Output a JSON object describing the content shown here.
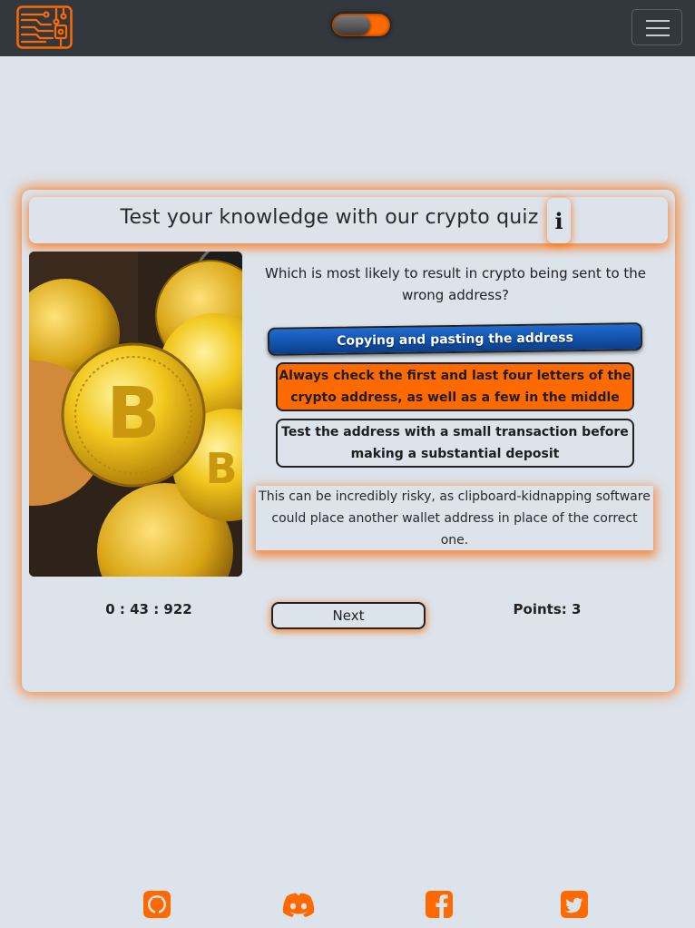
{
  "navbar": {
    "logo_icon": "circuit-chip-icon",
    "theme_toggle": "dark-mode-toggle",
    "menu_icon": "hamburger-icon"
  },
  "quiz": {
    "title": "Test your knowledge with our crypto quiz",
    "info_icon": "info-icon",
    "image": "bitcoin-and-dogecoin-coins-image",
    "question": "Which is most likely to result in crypto being sent to the wrong address?",
    "answers": [
      {
        "label": "Copying and pasting the address",
        "state": "selected"
      },
      {
        "label": "Always check the first and last four letters of the crypto address, as well as a few in the middle",
        "state": "highlighted"
      },
      {
        "label": "Test the address with a small transaction before making a substantial deposit",
        "state": "default"
      }
    ],
    "explanation": "This can be incredibly risky, as clipboard-kidnapping software could place another wallet address in place of the correct one.",
    "timer": "0 : 43 : 922",
    "next_label": "Next",
    "points": "Points: 3"
  },
  "footer": {
    "links": [
      "github-icon",
      "discord-icon",
      "facebook-icon",
      "twitter-icon"
    ]
  },
  "colors": {
    "accent": "#ff6a00",
    "navbar": "#32383e",
    "background": "#dce3ea",
    "selected_answer": "#0a3f8c"
  }
}
